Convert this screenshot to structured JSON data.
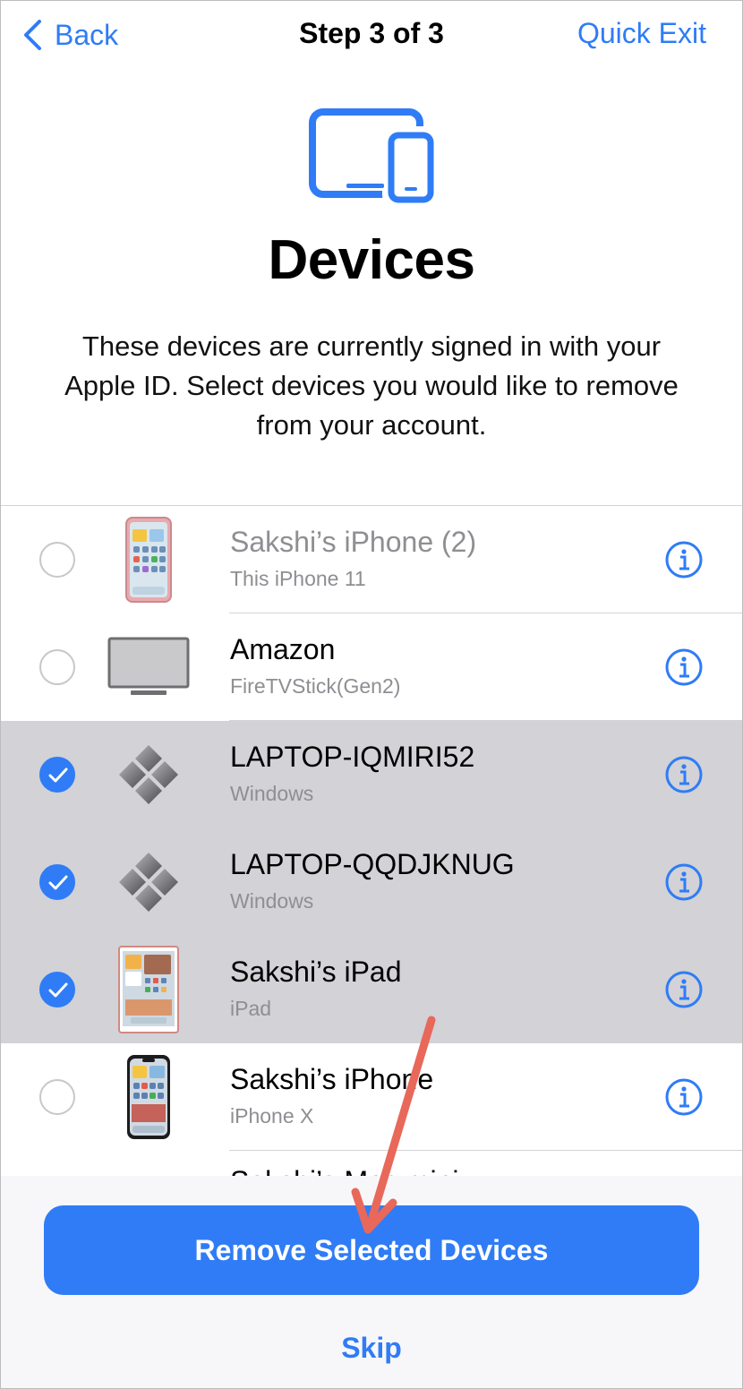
{
  "nav": {
    "back_label": "Back",
    "title": "Step 3 of 3",
    "quick_exit_label": "Quick Exit"
  },
  "page": {
    "title": "Devices",
    "description": "These devices are currently signed in with your Apple ID. Select devices you would like to remove from your account."
  },
  "devices": [
    {
      "name": "Sakshi’s iPhone (2)",
      "subtitle": "This iPhone 11",
      "selected": false,
      "dimmed": true,
      "icon": "iphone-icon"
    },
    {
      "name": "Amazon",
      "subtitle": "FireTVStick(Gen2)",
      "selected": false,
      "dimmed": false,
      "icon": "tv-icon"
    },
    {
      "name": "LAPTOP-IQMIRI52",
      "subtitle": "Windows",
      "selected": true,
      "dimmed": false,
      "icon": "windows-icon"
    },
    {
      "name": "LAPTOP-QQDJKNUG",
      "subtitle": "Windows",
      "selected": true,
      "dimmed": false,
      "icon": "windows-icon"
    },
    {
      "name": "Sakshi’s iPad",
      "subtitle": "iPad",
      "selected": true,
      "dimmed": false,
      "icon": "ipad-icon"
    },
    {
      "name": "Sakshi’s iPhone",
      "subtitle": "iPhone X",
      "selected": false,
      "dimmed": false,
      "icon": "iphone-x-icon"
    }
  ],
  "partial_row_text": "Sakshi’s Mac mini",
  "actions": {
    "remove_label": "Remove Selected Devices",
    "skip_label": "Skip"
  },
  "colors": {
    "accent": "#2f7cf6",
    "selected_row": "#d2d2d7",
    "annotation_arrow": "#e8685a"
  }
}
